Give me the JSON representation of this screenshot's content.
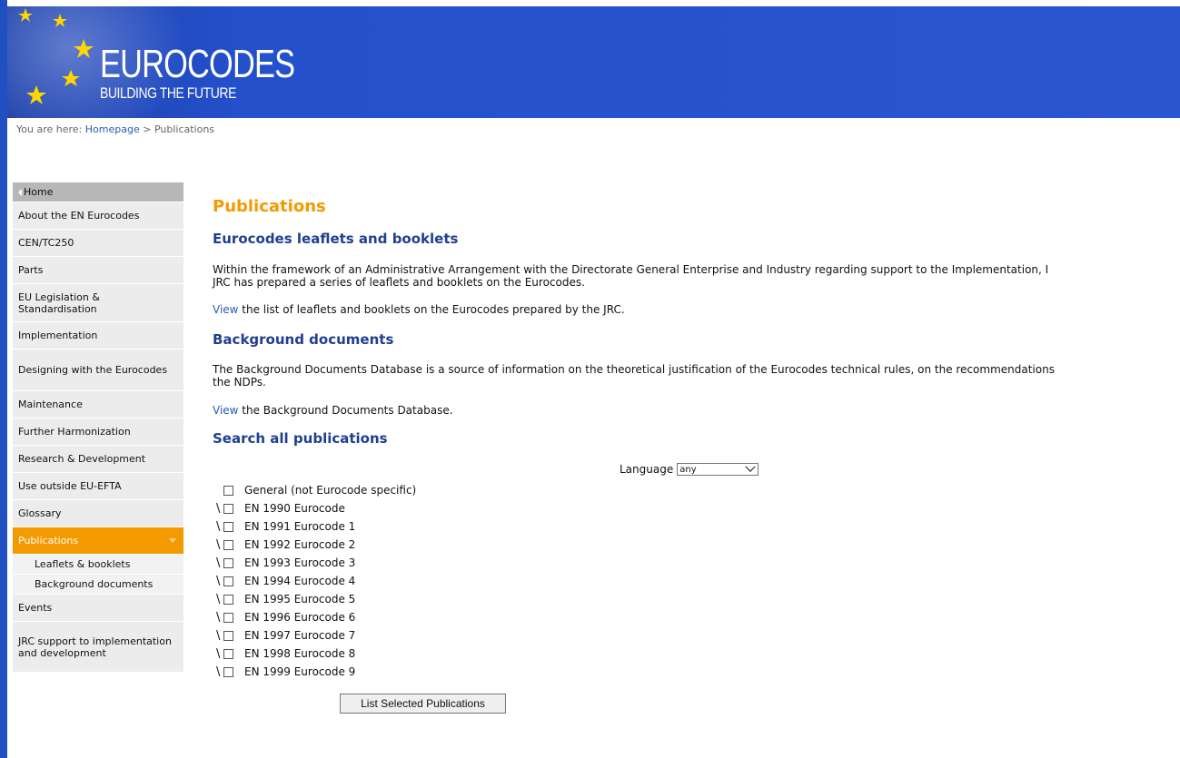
{
  "brand": {
    "title": "EUROCODES",
    "subtitle": "BUILDING THE FUTURE"
  },
  "breadcrumb": {
    "prefix": "You are here:",
    "home": "Homepage",
    "separator": ">",
    "current": "Publications"
  },
  "sidebar": {
    "items": [
      {
        "label": "Home"
      },
      {
        "label": "About the EN Eurocodes"
      },
      {
        "label": "CEN/TC250"
      },
      {
        "label": "Parts"
      },
      {
        "label": "EU Legislation & Standardisation"
      },
      {
        "label": "Implementation"
      },
      {
        "label": "Designing with the Eurocodes"
      },
      {
        "label": "Maintenance"
      },
      {
        "label": "Further Harmonization"
      },
      {
        "label": "Research & Development"
      },
      {
        "label": "Use outside EU-EFTA"
      },
      {
        "label": "Glossary"
      },
      {
        "label": "Publications"
      },
      {
        "label": "Events"
      },
      {
        "label": "JRC support to implementation and development"
      }
    ],
    "subitems": [
      {
        "label": "Leaflets & booklets"
      },
      {
        "label": "Background documents"
      }
    ],
    "active_color": "#f39a00"
  },
  "main": {
    "title": "Publications",
    "sections": [
      {
        "heading": "Eurocodes leaflets and booklets",
        "para_line1": "Within the framework of an Administrative Arrangement with the Directorate General Enterprise and Industry regarding support to the Implementation, I",
        "para_line2": "JRC has prepared a series of leaflets and booklets on the Eurocodes.",
        "link": "View",
        "link_rest": " the list of leaflets and booklets on the Eurocodes prepared by the JRC."
      },
      {
        "heading": "Background documents",
        "para_line1": "The Background Documents Database is a source of information on the theoretical justification of the Eurocodes technical rules, on the recommendations",
        "para_line2": "the NDPs.",
        "link": "View",
        "link_rest": " the Background Documents Database."
      },
      {
        "heading": "Search all publications"
      }
    ],
    "language": {
      "label": "Language",
      "selected": "any"
    },
    "checkboxes": [
      {
        "label": "General (not Eurocode specific)",
        "slash": ""
      },
      {
        "label": "EN 1990 Eurocode",
        "slash": "\\"
      },
      {
        "label": "EN 1991 Eurocode 1",
        "slash": "\\"
      },
      {
        "label": "EN 1992 Eurocode 2",
        "slash": "\\"
      },
      {
        "label": "EN 1993 Eurocode 3",
        "slash": "\\"
      },
      {
        "label": "EN 1994 Eurocode 4",
        "slash": "\\"
      },
      {
        "label": "EN 1995 Eurocode 5",
        "slash": "\\"
      },
      {
        "label": "EN 1996 Eurocode 6",
        "slash": "\\"
      },
      {
        "label": "EN 1997 Eurocode 7",
        "slash": "\\"
      },
      {
        "label": "EN 1998 Eurocode 8",
        "slash": "\\"
      },
      {
        "label": "EN 1999 Eurocode 9",
        "slash": "\\"
      }
    ],
    "submit_label": "List Selected Publications"
  },
  "colors": {
    "banner": "#2450cc",
    "heading": "#1f3f8f",
    "title": "#f39a00",
    "link": "#2a5bb3"
  }
}
